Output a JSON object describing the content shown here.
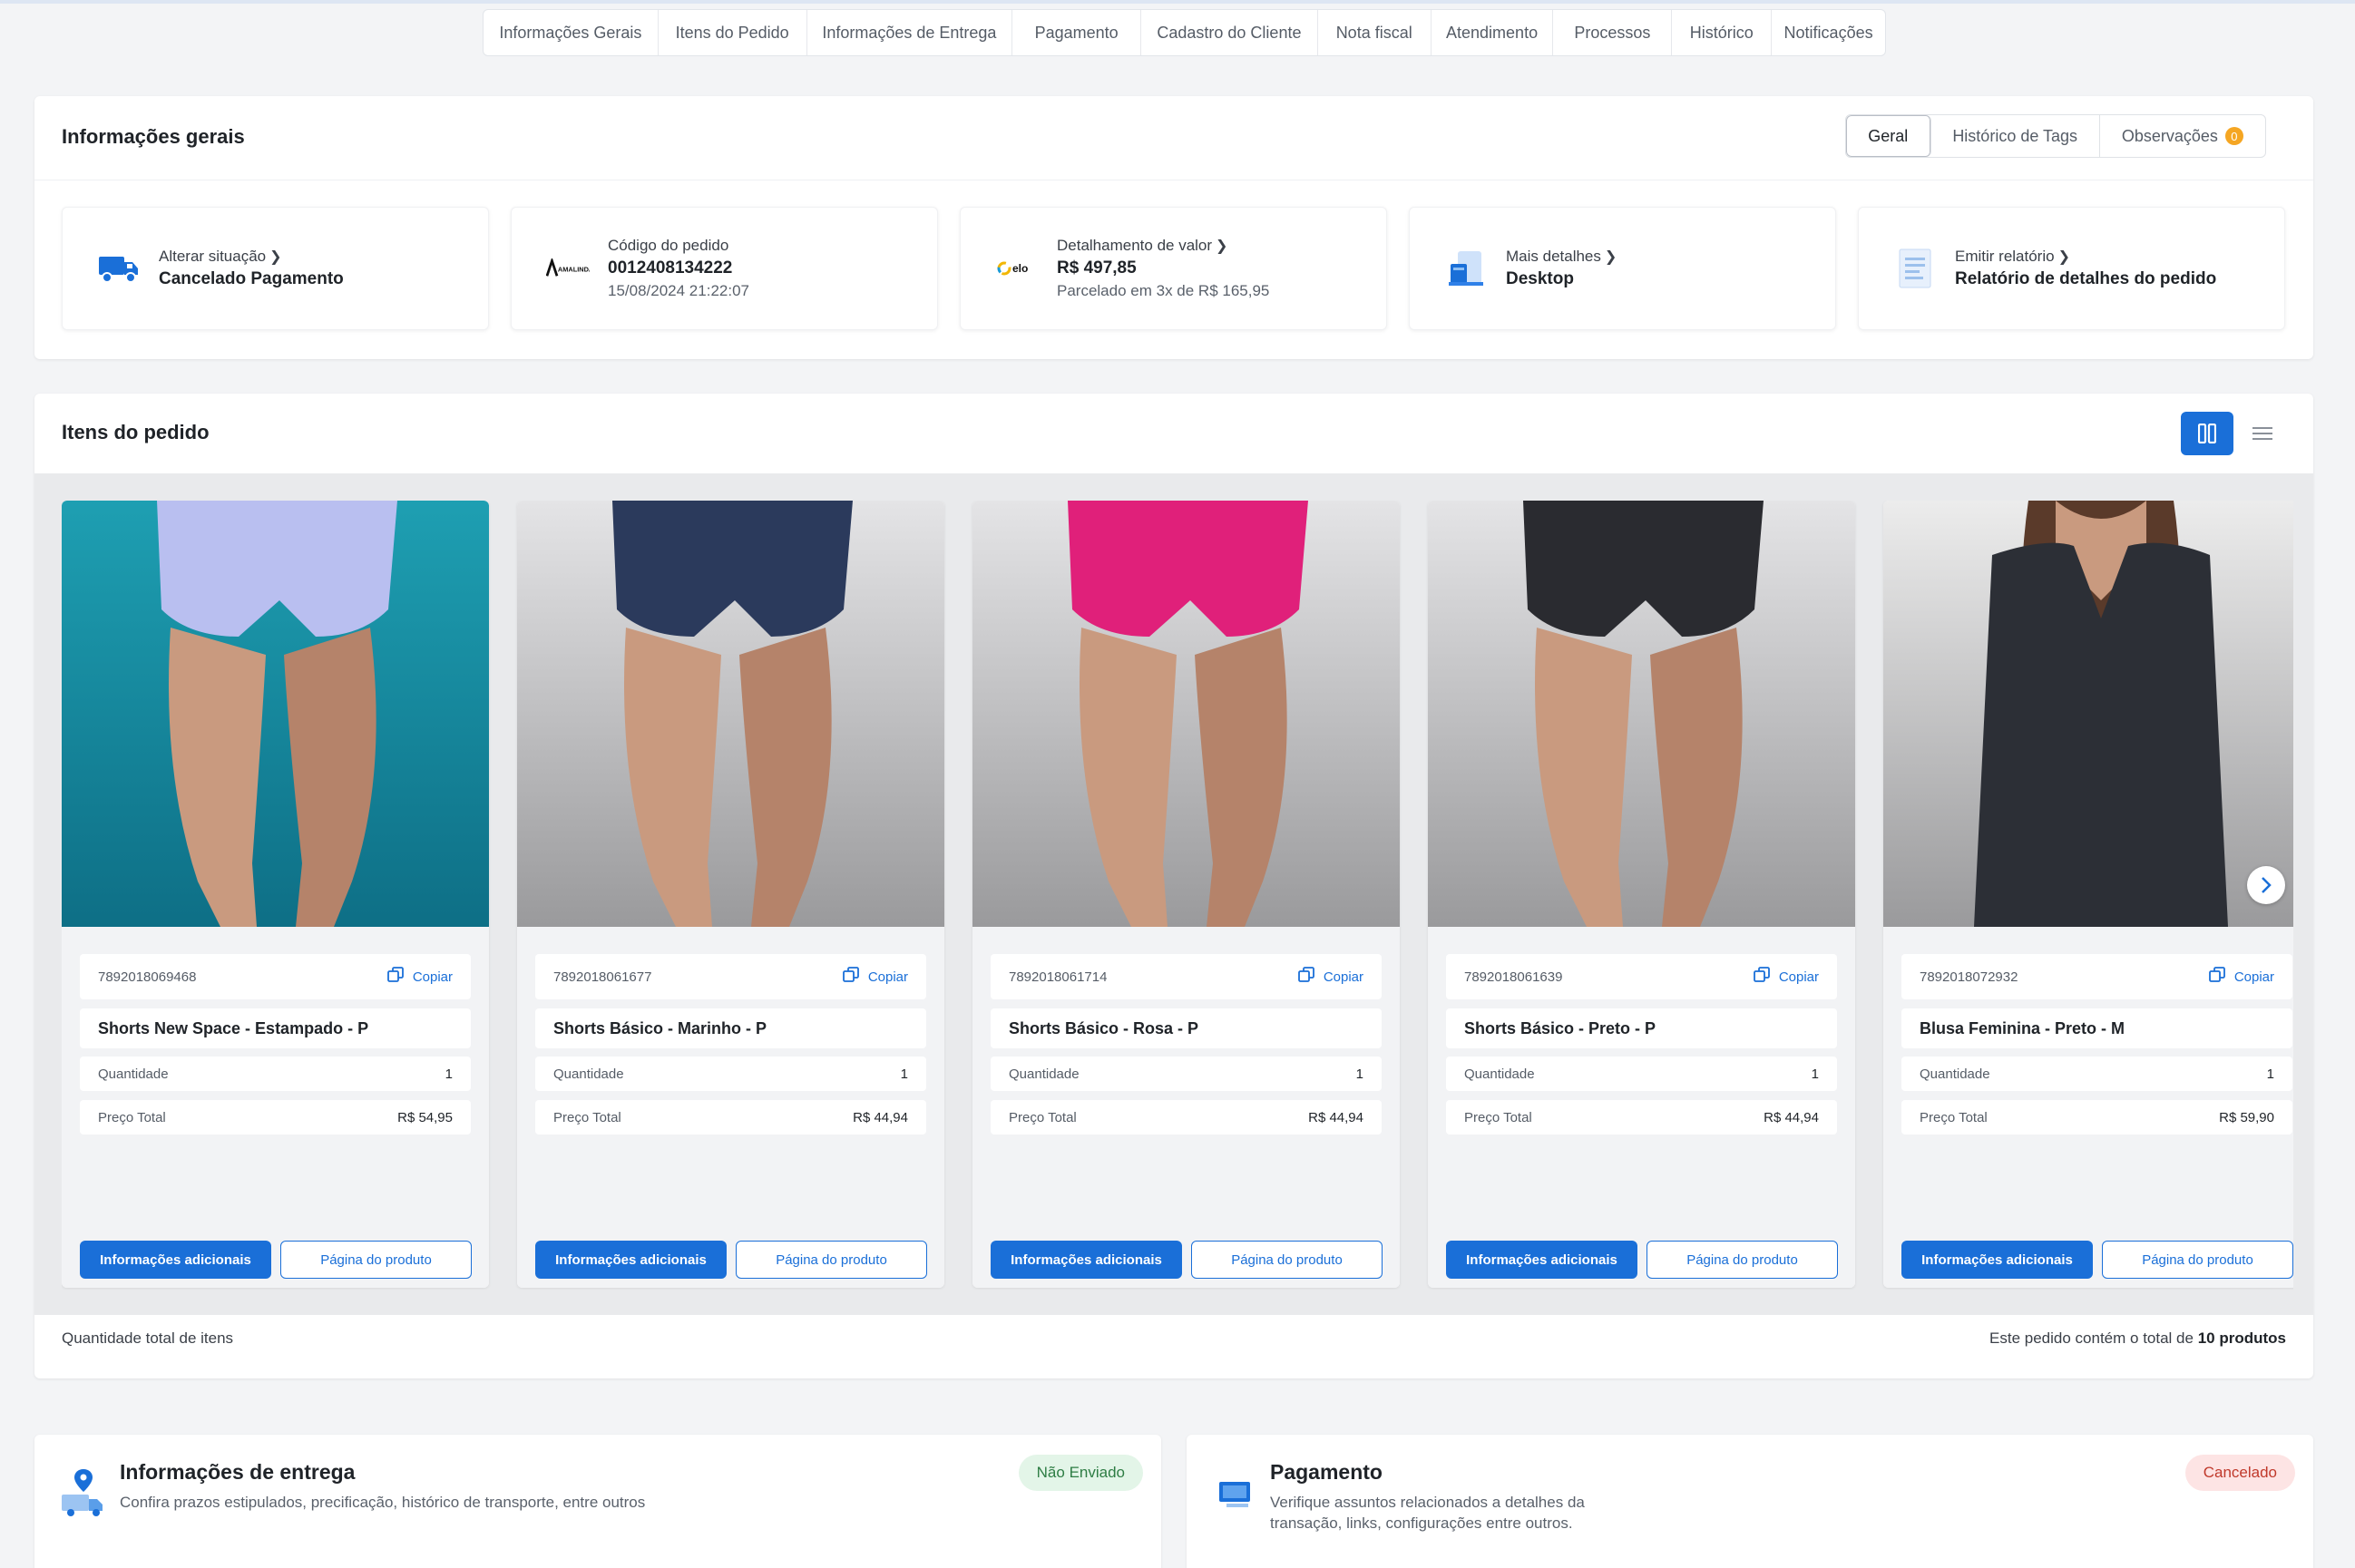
{
  "top_tabs": [
    "Informações Gerais",
    "Itens do Pedido",
    "Informações de Entrega",
    "Pagamento",
    "Cadastro do Cliente",
    "Nota fiscal",
    "Atendimento",
    "Processos",
    "Histórico",
    "Notificações"
  ],
  "info": {
    "title": "Informações gerais",
    "segments": {
      "geral": "Geral",
      "tags": "Histórico de Tags",
      "obs": "Observações",
      "obs_count": "0"
    },
    "situacao": {
      "label": "Alterar situação",
      "value": "Cancelado Pagamento"
    },
    "codigo": {
      "label": "Código do pedido",
      "value": "0012408134222",
      "date": "15/08/2024 21:22:07",
      "brand_logo": "AMALINDA"
    },
    "valor": {
      "label": "Detalhamento de valor",
      "value": "R$ 497,85",
      "sub": "Parcelado em 3x de R$ 165,95",
      "card_brand": "elo"
    },
    "detalhes": {
      "label": "Mais detalhes",
      "value": "Desktop"
    },
    "relatorio": {
      "label": "Emitir relatório",
      "value": "Relatório de detalhes do pedido"
    }
  },
  "items": {
    "title": "Itens do pedido",
    "labels": {
      "copy": "Copiar",
      "qty": "Quantidade",
      "total": "Preço Total",
      "more_info": "Informações adicionais",
      "product_page": "Página do produto"
    },
    "products": [
      {
        "sku": "7892018069468",
        "name": "Shorts New Space - Estampado - P",
        "qty": "1",
        "price": "R$ 54,95",
        "color": "#b9bff0",
        "bg": "#1e9fb2"
      },
      {
        "sku": "7892018061677",
        "name": "Shorts Básico - Marinho - P",
        "qty": "1",
        "price": "R$ 44,94",
        "color": "#2b3a5c",
        "bg": "#e4e4e6"
      },
      {
        "sku": "7892018061714",
        "name": "Shorts Básico - Rosa - P",
        "qty": "1",
        "price": "R$ 44,94",
        "color": "#e0207a",
        "bg": "#e4e4e6"
      },
      {
        "sku": "7892018061639",
        "name": "Shorts Básico - Preto - P",
        "qty": "1",
        "price": "R$ 44,94",
        "color": "#2a2b30",
        "bg": "#e4e4e6"
      },
      {
        "sku": "7892018072932",
        "name": "Blusa Feminina - Preto - M",
        "qty": "1",
        "price": "R$ 59,90",
        "color": "#2c2f36",
        "bg": "#ececec"
      }
    ],
    "footer_left": "Quantidade total de itens",
    "footer_right_prefix": "Este pedido contém o total de",
    "footer_right_count": "10 produtos"
  },
  "entrega": {
    "title": "Informações de entrega",
    "desc": "Confira prazos estipulados, precificação, histórico de transporte, entre outros",
    "status": "Não Enviado"
  },
  "pagamento": {
    "title": "Pagamento",
    "desc_line1": "Verifique assuntos relacionados a detalhes da",
    "desc_line2": "transação, links, configurações entre outros.",
    "status": "Cancelado"
  },
  "colors": {
    "primary": "#1a6fd8",
    "success_bg": "#e3f5e8",
    "success_text": "#2e7d44",
    "danger_bg": "#fde4e4",
    "danger_text": "#c0392b"
  }
}
